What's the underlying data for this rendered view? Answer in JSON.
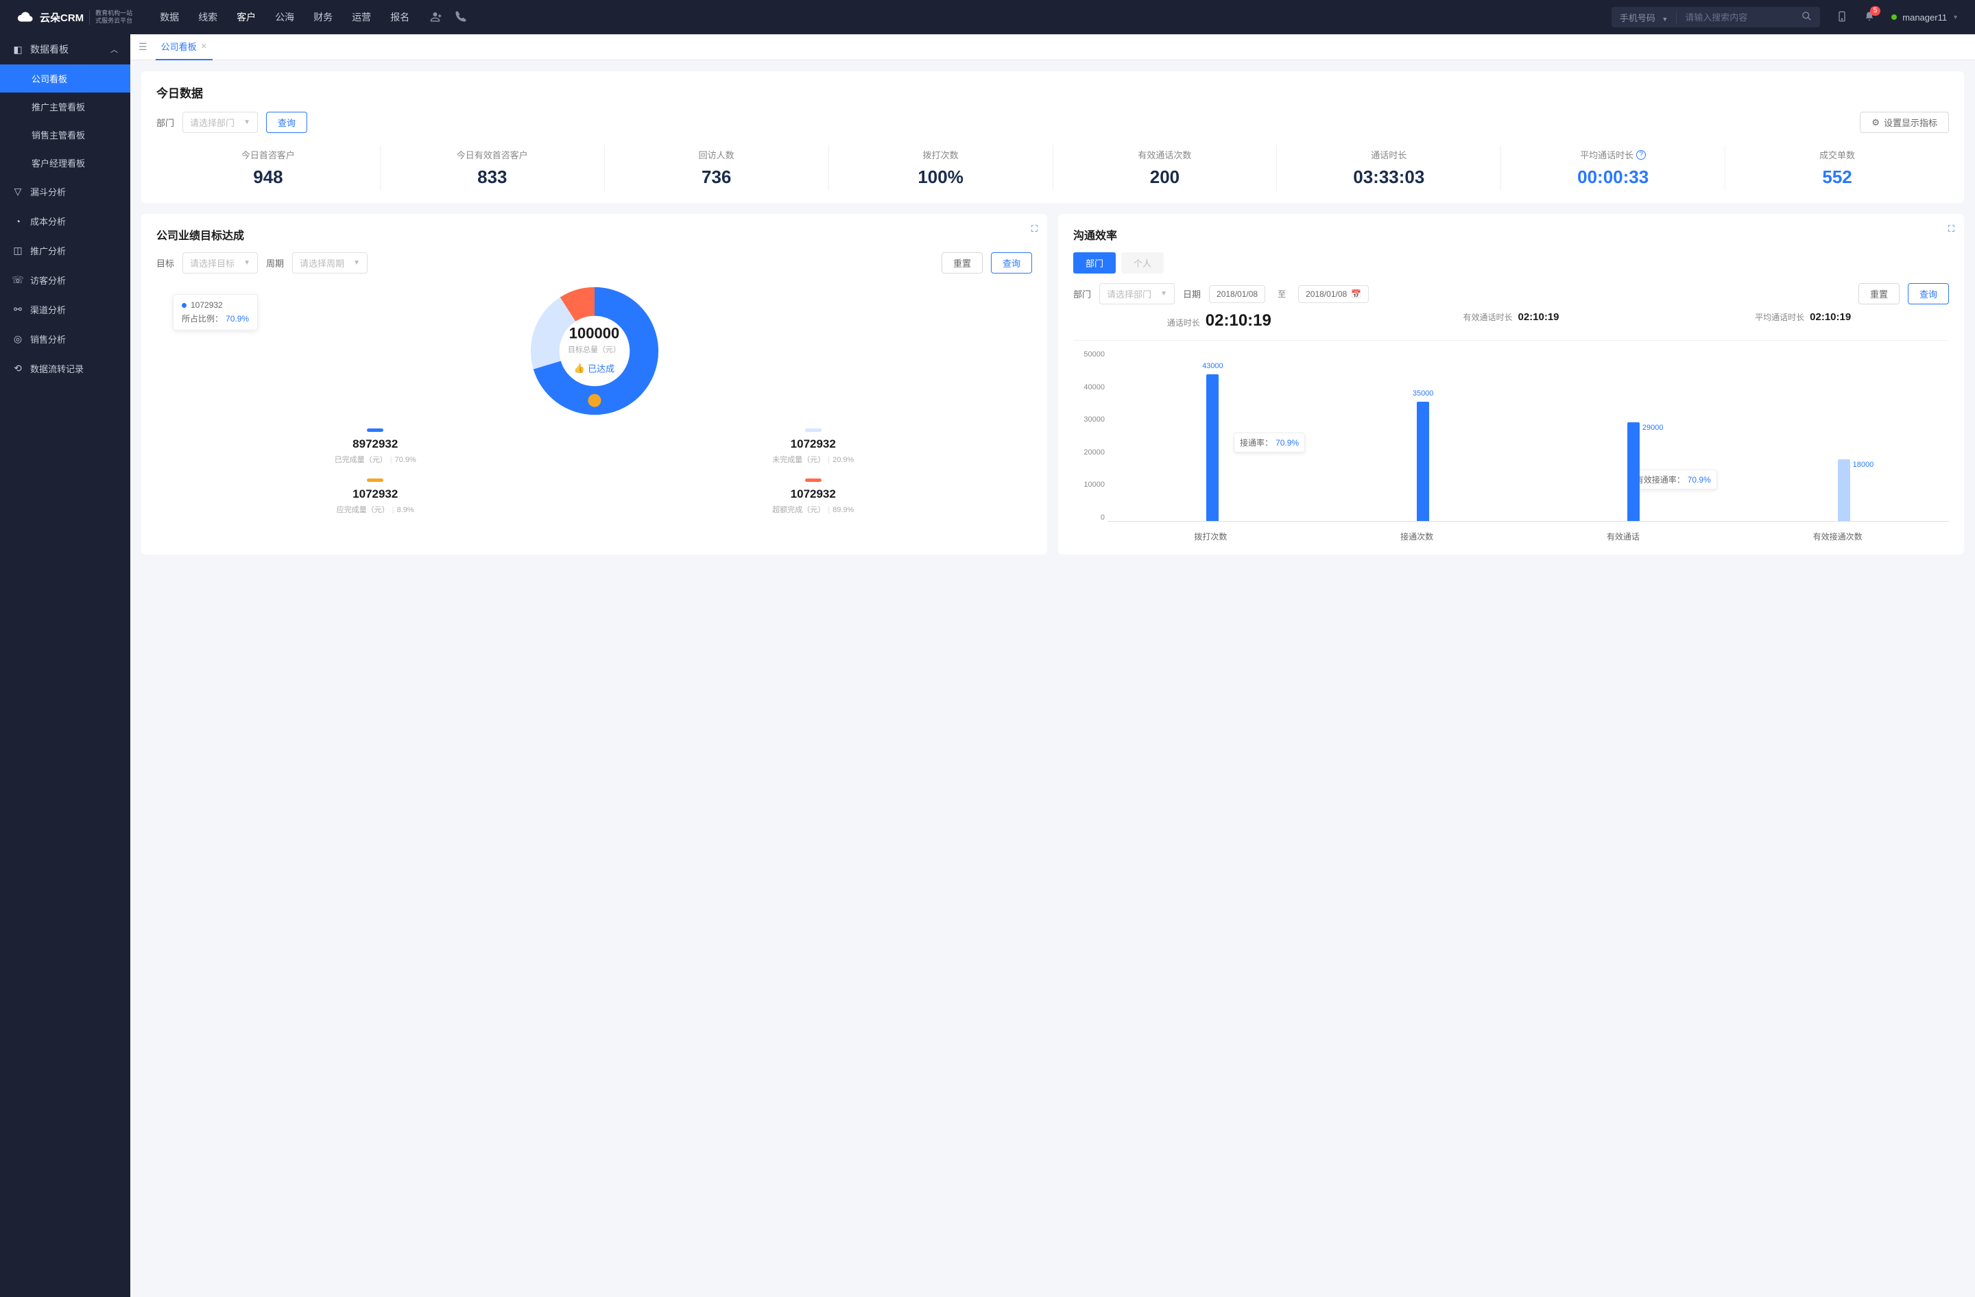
{
  "header": {
    "logo_main": "云朵CRM",
    "logo_sub1": "教育机构一站",
    "logo_sub2": "式服务云平台",
    "nav": [
      "数据",
      "线索",
      "客户",
      "公海",
      "财务",
      "运营",
      "报名"
    ],
    "nav_active": 2,
    "search_type": "手机号码",
    "search_placeholder": "请输入搜索内容",
    "badge_count": "5",
    "username": "manager11"
  },
  "sidebar": {
    "group_label": "数据看板",
    "subs": [
      "公司看板",
      "推广主管看板",
      "销售主管看板",
      "客户经理看板"
    ],
    "sub_active": 0,
    "items": [
      {
        "icon": "funnel",
        "label": "漏斗分析"
      },
      {
        "icon": "clock",
        "label": "成本分析"
      },
      {
        "icon": "chart",
        "label": "推广分析"
      },
      {
        "icon": "headset",
        "label": "访客分析"
      },
      {
        "icon": "channel",
        "label": "渠道分析"
      },
      {
        "icon": "target",
        "label": "销售分析"
      },
      {
        "icon": "flow",
        "label": "数据流转记录"
      }
    ]
  },
  "tabs": {
    "active": "公司看板"
  },
  "today": {
    "title": "今日数据",
    "dept_label": "部门",
    "dept_placeholder": "请选择部门",
    "query": "查询",
    "settings": "设置显示指标",
    "kpis": [
      {
        "label": "今日首咨客户",
        "value": "948",
        "color": "dark"
      },
      {
        "label": "今日有效首咨客户",
        "value": "833",
        "color": "dark"
      },
      {
        "label": "回访人数",
        "value": "736",
        "color": "dark"
      },
      {
        "label": "拨打次数",
        "value": "100%",
        "color": "dark"
      },
      {
        "label": "有效通话次数",
        "value": "200",
        "color": "dark"
      },
      {
        "label": "通话时长",
        "value": "03:33:03",
        "color": "dark"
      },
      {
        "label": "平均通话时长",
        "value": "00:00:33",
        "color": "blue",
        "info": true
      },
      {
        "label": "成交单数",
        "value": "552",
        "color": "blue"
      }
    ]
  },
  "goal": {
    "title": "公司业绩目标达成",
    "target_label": "目标",
    "target_placeholder": "请选择目标",
    "period_label": "周期",
    "period_placeholder": "请选择周期",
    "reset": "重置",
    "query": "查询",
    "center_value": "100000",
    "center_label": "目标总量（元）",
    "achieved": "已达成",
    "tooltip_value": "1072932",
    "tooltip_ratio_label": "所占比例：",
    "tooltip_ratio": "70.9%",
    "legend": [
      {
        "color": "#2878ff",
        "value": "8972932",
        "desc": "已完成量（元）",
        "pct": "70.9%"
      },
      {
        "color": "#d6e6ff",
        "value": "1072932",
        "desc": "未完成量（元）",
        "pct": "20.9%"
      },
      {
        "color": "#f5a623",
        "value": "1072932",
        "desc": "应完成量（元）",
        "pct": "8.9%"
      },
      {
        "color": "#ff6b4a",
        "value": "1072932",
        "desc": "超额完成（元）",
        "pct": "89.9%"
      }
    ]
  },
  "comm": {
    "title": "沟通效率",
    "seg_dept": "部门",
    "seg_person": "个人",
    "dept_label": "部门",
    "dept_placeholder": "请选择部门",
    "date_label": "日期",
    "date_from": "2018/01/08",
    "date_sep": "至",
    "date_to": "2018/01/08",
    "reset": "重置",
    "query": "查询",
    "summary": [
      {
        "label": "通话时长",
        "value": "02:10:19",
        "size": "big"
      },
      {
        "label": "有效通话时长",
        "value": "02:10:19",
        "size": "small"
      },
      {
        "label": "平均通话时长",
        "value": "02:10:19",
        "size": "small"
      }
    ],
    "annot1_label": "接通率：",
    "annot1_pct": "70.9%",
    "annot2_label": "有效接通率：",
    "annot2_pct": "70.9%"
  },
  "chart_data": {
    "type": "bar",
    "categories": [
      "拨打次数",
      "接通次数",
      "有效通话",
      "有效接通次数"
    ],
    "values": [
      43000,
      35000,
      29000,
      18000
    ],
    "light_index": 3,
    "ylim": [
      0,
      50000
    ],
    "y_ticks": [
      0,
      10000,
      20000,
      30000,
      40000,
      50000
    ],
    "annotations": [
      {
        "after_index": 0,
        "label": "接通率：",
        "pct": "70.9%"
      },
      {
        "after_index": 2,
        "label": "有效接通率：",
        "pct": "70.9%"
      }
    ]
  }
}
